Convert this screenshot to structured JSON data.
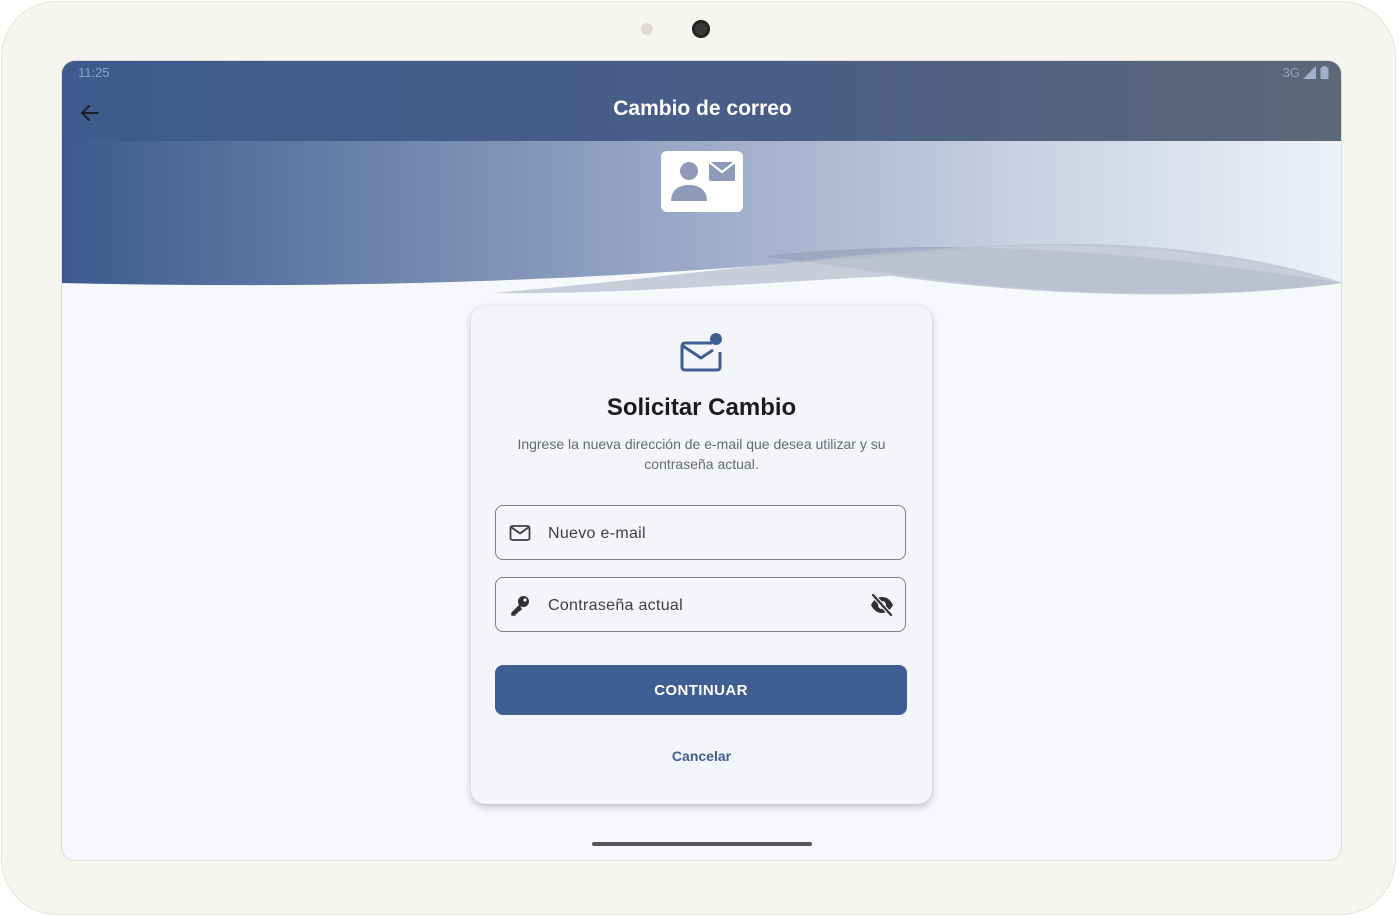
{
  "status_bar": {
    "time": "11:25",
    "network": "3G",
    "icons": [
      "signal-icon",
      "battery-icon"
    ]
  },
  "app_bar": {
    "title": "Cambio de correo",
    "back_icon": "arrow-back-icon"
  },
  "header": {
    "icon": "contact-mail-icon"
  },
  "card": {
    "icon": "mark-email-unread-icon",
    "title": "Solicitar Cambio",
    "description": "Ingrese la nueva dirección de e-mail que desea utilizar y su contraseña actual.",
    "email_field": {
      "icon": "mail-outline-icon",
      "placeholder": "Nuevo e-mail",
      "value": ""
    },
    "password_field": {
      "icon": "key-icon",
      "placeholder": "Contraseña actual",
      "value": "",
      "toggle_icon": "visibility-off-icon"
    },
    "continue_label": "CONTINUAR",
    "cancel_label": "Cancelar"
  },
  "colors": {
    "primary": "#3f5e91",
    "appbar_start": "#3e5b8f",
    "appbar_end": "#5c6878",
    "background": "#f7f8fc",
    "card": "#f4f5fa"
  }
}
